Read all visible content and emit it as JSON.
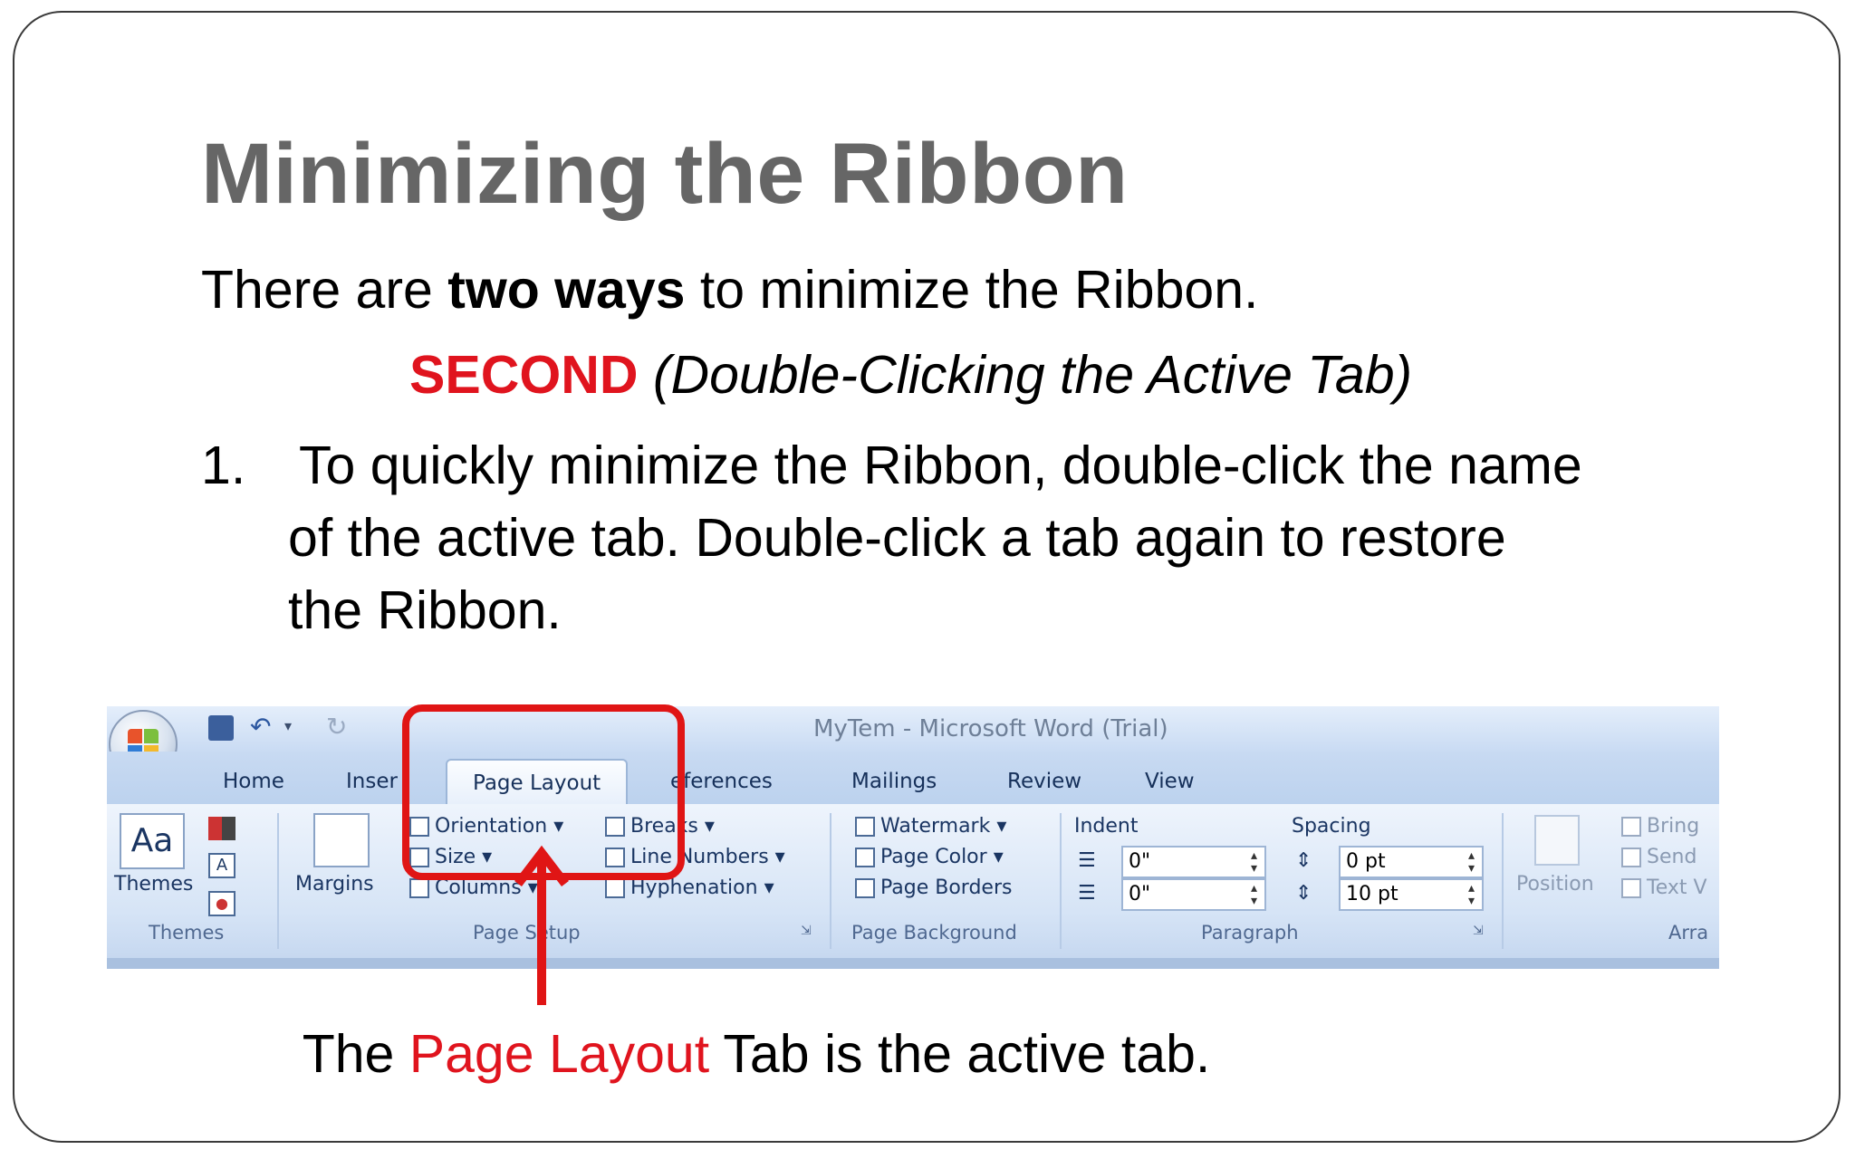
{
  "slide": {
    "title": "Minimizing the Ribbon",
    "intro_pre": "There are ",
    "intro_bold": "two ways",
    "intro_post": " to minimize the Ribbon.",
    "second_label": "SECOND",
    "second_note": " (Double-Clicking the Active Tab)",
    "step_number": "1.",
    "step_line1": "To quickly minimize the Ribbon, double-click the name",
    "step_line2": "of the active tab. Double-click a tab again to restore",
    "step_line3": "the Ribbon.",
    "caption_pre": "The ",
    "caption_red": "Page Layout",
    "caption_post": " Tab is the active tab."
  },
  "ribbon": {
    "window_title": "MyTem - Microsoft Word (Trial)",
    "tabs": [
      "Home",
      "Inser",
      "Page Layout",
      "eferences",
      "Mailings",
      "Review",
      "View"
    ],
    "active_tab": "Page Layout",
    "groups": {
      "themes": {
        "label": "Themes",
        "button": "Themes"
      },
      "page_setup": {
        "label": "Page Setup",
        "margins": "Margins",
        "orientation": "Orientation",
        "size": "Size",
        "columns": "Columns",
        "breaks": "Breaks",
        "line_numbers": "Line Numbers",
        "hyphenation": "Hyphenation"
      },
      "page_background": {
        "label": "Page Background",
        "watermark": "Watermark",
        "page_color": "Page Color",
        "page_borders": "Page Borders"
      },
      "paragraph": {
        "label": "Paragraph",
        "indent_header": "Indent",
        "spacing_header": "Spacing",
        "indent_left": "0\"",
        "indent_right": "0\"",
        "spacing_before": "0 pt",
        "spacing_after": "10 pt"
      },
      "arrange": {
        "label": "Arra",
        "position": "Position",
        "bring": "Bring",
        "send": "Send",
        "text_wrap": "Text V"
      }
    }
  },
  "colors": {
    "title_gray": "#666666",
    "accent_red": "#e0141e",
    "ribbon_blue": "#cfdff2"
  }
}
